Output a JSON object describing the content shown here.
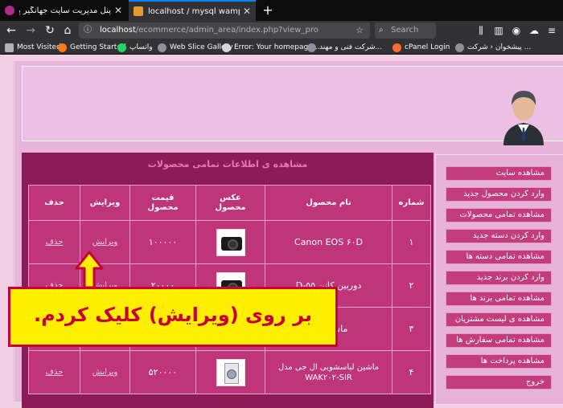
{
  "browser": {
    "tabs": [
      {
        "title": "پنل مدیریت سایت جهانگیر پنچکم",
        "active": false
      },
      {
        "title": "localhost / mysql wampserver | php",
        "active": true
      }
    ],
    "url_host": "localhost",
    "url_rest": "/ecommerce/admin_area/index.php?view_pro",
    "search_placeholder": "Search",
    "bookmarks": [
      {
        "label": "Most Visited"
      },
      {
        "label": "Getting Started"
      },
      {
        "label": "واتساپ"
      },
      {
        "label": "Web Slice Gallery"
      },
      {
        "label": "Error: Your homepage..."
      },
      {
        "label": "شرکت فنی و مهند..."
      },
      {
        "label": "cPanel Login"
      },
      {
        "label": "پیشخوان ‹ شرکت ..."
      }
    ]
  },
  "page": {
    "content_title": "مشاهده ی اطلاعات تمامی محصولات",
    "table": {
      "headers": {
        "number": "شماره",
        "name": "نام محصول",
        "image_line1": "عکس",
        "image_line2": "محصول",
        "price_line1": "قیمت",
        "price_line2": "محصول",
        "edit": "ویرایش",
        "delete": "حذف"
      },
      "rows": [
        {
          "number": "۱",
          "name": "Canon EOS ۶۰D",
          "price": "۱۰۰۰۰۰",
          "edit": "ویرایش",
          "delete": "حذف"
        },
        {
          "number": "۲",
          "name": "دوربین کانن ۵۵-D",
          "price": "۲۰۰۰۰",
          "edit": "ویرایش",
          "delete": "حذف"
        },
        {
          "number": "۳",
          "name": "ماشین لب",
          "price": "",
          "edit": "",
          "delete": ""
        },
        {
          "number": "۴",
          "name": "ماشین لباسشویی ال جی مدل WAK۲۰۲-SIR",
          "price": "۵۲۰۰۰۰",
          "edit": "ویرایش",
          "delete": "حذف"
        }
      ]
    },
    "sidebar_menu": [
      "مشاهده سایت",
      "وارد کردن محصول جدید",
      "مشاهده تمامی محصولات",
      "وارد کردن دسته جدید",
      "مشاهده تمامی دسته ها",
      "وارد کردن برند جدید",
      "مشاهده تمامی برند ها",
      "مشاهده ی لیست مشتریان",
      "مشاهده تمامی سفارش ها",
      "مشاهده پرداخت ها",
      "خروج"
    ]
  },
  "annotation": {
    "text": "بر روی (ویرایش) کلیک کردم."
  },
  "colors": {
    "chrome_dark": "#0c0c0d",
    "chrome_toolbar": "#323234",
    "page_bg": "#f3cfe6",
    "content_bg": "#8d1b58",
    "cell_bg": "#c0347a",
    "menu_item_bg": "#c33c7b",
    "callout_bg": "#ffee00",
    "callout_border": "#c8003a"
  }
}
